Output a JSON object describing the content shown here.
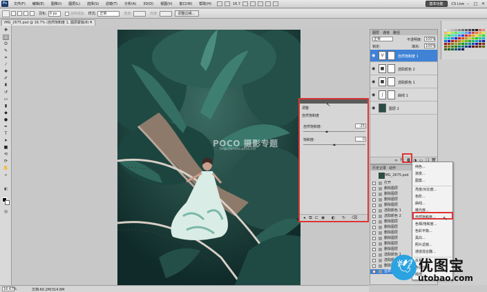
{
  "menubar": {
    "logo": "Ps",
    "items": [
      "文件(F)",
      "编辑(E)",
      "图像(I)",
      "图层(L)",
      "选择(S)",
      "滤镜(T)",
      "分析(A)",
      "3D(D)",
      "视图(V)",
      "窗口(W)",
      "帮助(H)"
    ],
    "zoom": "16.7",
    "workspace": "基本功能",
    "cslive": "CS Live",
    "win_controls": [
      "–",
      "□",
      "✕"
    ]
  },
  "optionsbar": {
    "feather_label": "羽化:",
    "feather_value": "0 px",
    "antialias_label": "消除锯齿",
    "style_label": "样式:",
    "style_value": "正常",
    "width_label": "宽度:",
    "height_label": "高度:",
    "refine_button": "调整边缘..."
  },
  "document": {
    "tab_title": "IMG_2675.psd @ 16.7% (自然饱和度 1, 图层蒙版/8) *",
    "close": "×",
    "watermark_brand": "POCO 摄影专题",
    "watermark_url": "http://photo.poco.cn/"
  },
  "properties": {
    "title": "调整",
    "subtitle": "自然饱和度",
    "vibrance_label": "自然饱和度:",
    "vibrance_value": "-25",
    "vibrance_level": -25,
    "saturation_label": "饱和度:",
    "saturation_value": "0",
    "saturation_level": 0
  },
  "layers": {
    "tabs": [
      "图层",
      "通道",
      "路径"
    ],
    "blend_mode": "正常",
    "opacity_label": "不透明度:",
    "opacity_value": "100%",
    "lock_label": "锁定:",
    "fill_label": "填充:",
    "fill_value": "100%",
    "items": [
      {
        "name": "自然饱和度 1",
        "icon": "V"
      },
      {
        "name": "选取颜色 2",
        "icon": "■"
      },
      {
        "name": "选取颜色 1",
        "icon": "■"
      },
      {
        "name": "曲线 1",
        "icon": "∫"
      },
      {
        "name": "图层 2",
        "icon": ""
      }
    ],
    "footer_icons": [
      "link-icon",
      "fx-icon",
      "mask-icon",
      "adjustment-icon",
      "group-icon",
      "new-layer-icon",
      "trash-icon"
    ]
  },
  "history": {
    "tabs": [
      "历史记录",
      "动作"
    ],
    "snapshot": "IMG_2675.psd",
    "items": [
      "打开",
      "删除图层",
      "删除图层",
      "删除图层",
      "删除图层",
      "选取颜色 1",
      "选取颜色 2",
      "删除图层",
      "删除图层",
      "删除图层",
      "删除图层",
      "删除图层",
      "删除图层",
      "选取颜色 1",
      "选取颜色 2",
      "删除图层",
      "合并可见图层"
    ]
  },
  "context_menu": {
    "items": [
      "纯色...",
      "渐变...",
      "图案...",
      "亮度/对比度...",
      "色阶...",
      "曲线...",
      "曝光度...",
      "自然饱和度...",
      "色相/饱和度...",
      "色彩平衡...",
      "黑白...",
      "照片滤镜...",
      "通道混合器...",
      "反相",
      "色调分离...",
      "阈值..."
    ],
    "highlighted": "自然饱和度..."
  },
  "statusbar": {
    "zoom": "16.67%",
    "doc_info": "文档:60.2M/314.6M"
  },
  "site_logo": {
    "cn": "优图宝",
    "en": "utobao.com"
  }
}
